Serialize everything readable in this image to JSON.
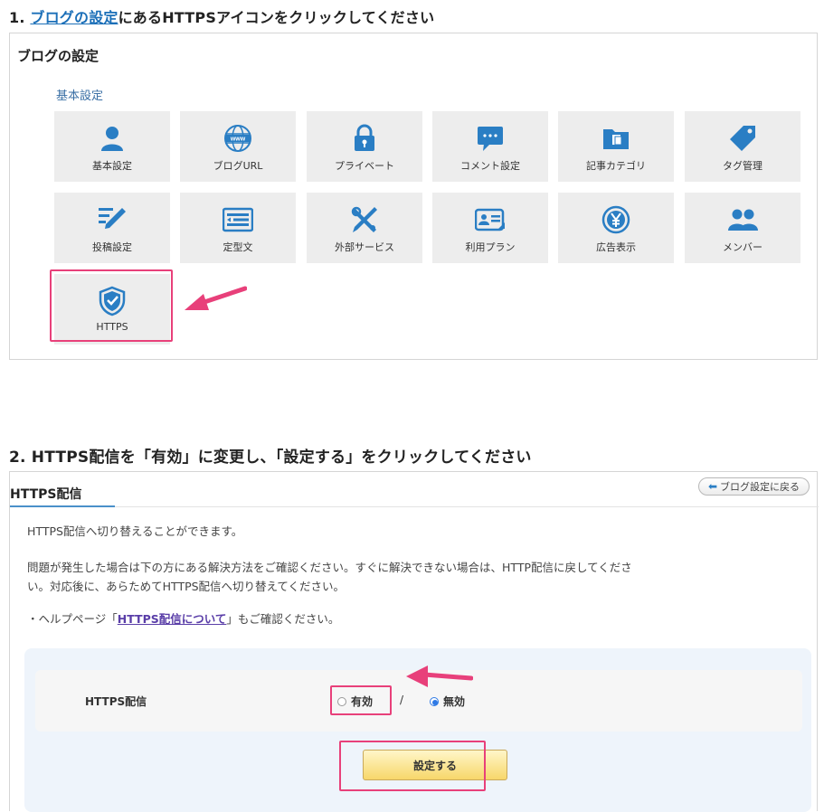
{
  "step1": {
    "number": "1.",
    "link_text": "ブログの設定",
    "rest_text": "にあるHTTPSアイコンをクリックしてください"
  },
  "panel1": {
    "title": "ブログの設定",
    "section_label": "基本設定",
    "tiles": [
      {
        "label": "基本設定",
        "icon": "user-icon"
      },
      {
        "label": "ブログURL",
        "icon": "www-globe-icon"
      },
      {
        "label": "プライベート",
        "icon": "lock-icon"
      },
      {
        "label": "コメント設定",
        "icon": "comment-bubble-icon"
      },
      {
        "label": "記事カテゴリ",
        "icon": "folder-icon"
      },
      {
        "label": "タグ管理",
        "icon": "tag-icon"
      },
      {
        "label": "投稿設定",
        "icon": "pencil-icon"
      },
      {
        "label": "定型文",
        "icon": "template-list-icon"
      },
      {
        "label": "外部サービス",
        "icon": "tools-icon"
      },
      {
        "label": "利用プラン",
        "icon": "id-card-icon"
      },
      {
        "label": "広告表示",
        "icon": "yen-icon"
      },
      {
        "label": "メンバー",
        "icon": "members-icon"
      },
      {
        "label": "HTTPS",
        "icon": "shield-check-icon"
      }
    ]
  },
  "step2": {
    "text": "2. HTTPS配信を「有効」に変更し、「設定する」をクリックしてください"
  },
  "panel2": {
    "title": "HTTPS配信",
    "back_button": "ブログ設定に戻る",
    "para1": "HTTPS配信へ切り替えることができます。",
    "para2_line1": "問題が発生した場合は下の方にある解決方法をご確認ください。すぐに解決できない場合は、HTTP配信に戻してくださ",
    "para2_line2": "い。対応後に、あらためてHTTPS配信へ切り替えてください。",
    "help_prefix": "・ヘルプページ「",
    "help_link": "HTTPS配信について",
    "help_suffix": "」もご確認ください。",
    "form_label": "HTTPS配信",
    "option_enable": "有効",
    "separator": "/",
    "option_disable": "無効",
    "selected": "無効",
    "submit_label": "設定する"
  },
  "colors": {
    "highlight": "#e8407a",
    "icon_blue": "#2a7ec4",
    "link": "#1b6fb8"
  }
}
